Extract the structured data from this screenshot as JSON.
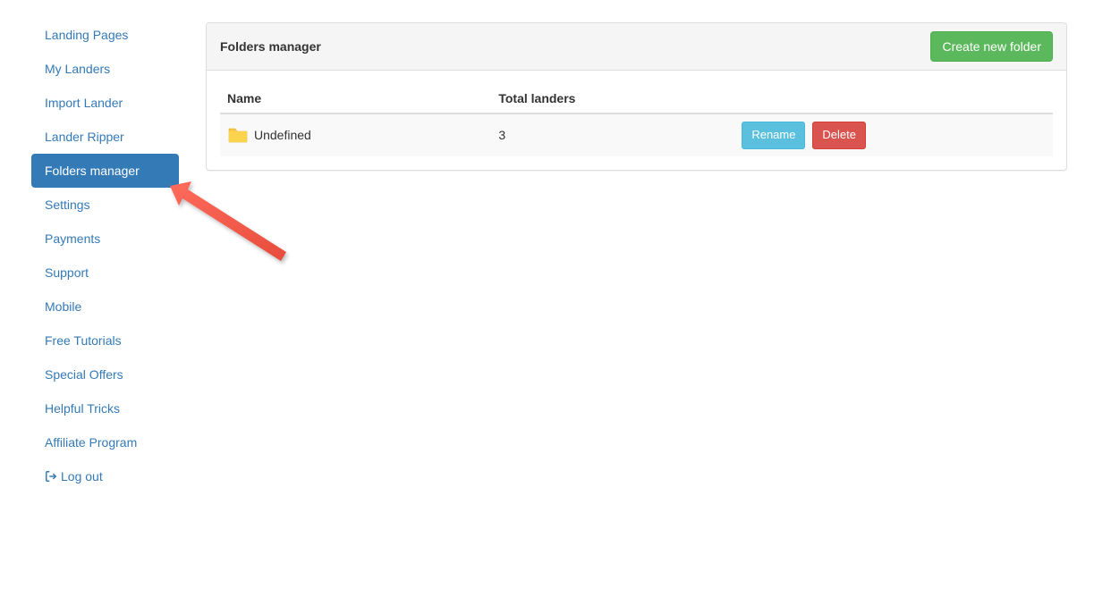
{
  "sidebar": {
    "items": [
      {
        "label": "Landing Pages",
        "name": "sidebar-item-landing-pages"
      },
      {
        "label": "My Landers",
        "name": "sidebar-item-my-landers"
      },
      {
        "label": "Import Lander",
        "name": "sidebar-item-import-lander"
      },
      {
        "label": "Lander Ripper",
        "name": "sidebar-item-lander-ripper"
      },
      {
        "label": "Folders manager",
        "name": "sidebar-item-folders-manager",
        "active": true
      },
      {
        "label": "Settings",
        "name": "sidebar-item-settings"
      },
      {
        "label": "Payments",
        "name": "sidebar-item-payments"
      },
      {
        "label": "Support",
        "name": "sidebar-item-support"
      },
      {
        "label": "Mobile",
        "name": "sidebar-item-mobile"
      },
      {
        "label": "Free Tutorials",
        "name": "sidebar-item-free-tutorials"
      },
      {
        "label": "Special Offers",
        "name": "sidebar-item-special-offers"
      },
      {
        "label": "Helpful Tricks",
        "name": "sidebar-item-helpful-tricks"
      },
      {
        "label": "Affiliate Program",
        "name": "sidebar-item-affiliate-program"
      }
    ],
    "logout_label": "Log out"
  },
  "panel": {
    "title": "Folders manager",
    "create_button": "Create new folder"
  },
  "table": {
    "columns": {
      "name": "Name",
      "total_landers": "Total landers"
    },
    "rows": [
      {
        "name": "Undefined",
        "total_landers": "3",
        "rename_label": "Rename",
        "delete_label": "Delete"
      }
    ]
  }
}
